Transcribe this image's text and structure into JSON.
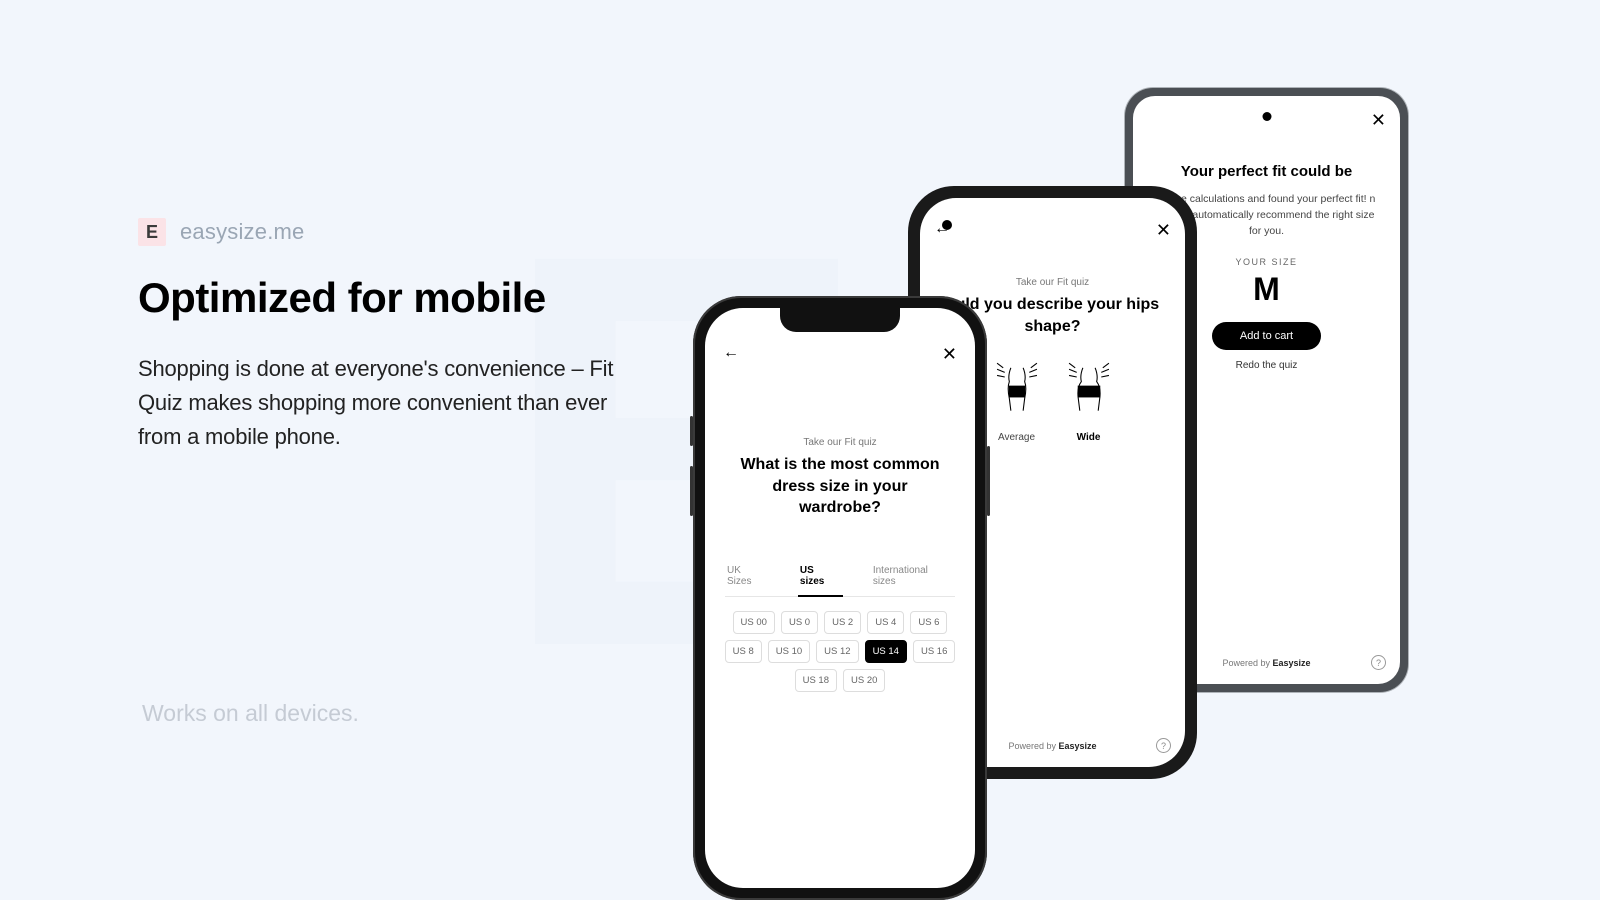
{
  "brand": {
    "badge": "E",
    "name": "easysize.me"
  },
  "title": "Optimized for mobile",
  "body": "Shopping is done at everyone's convenience – Fit Quiz makes shopping more convenient than ever from a mobile phone.",
  "footer": "Works on all devices.",
  "phoneA": {
    "label": "Take our Fit quiz",
    "question": "What is the most common dress size in your wardrobe?",
    "tabs": [
      "UK Sizes",
      "US sizes",
      "International sizes"
    ],
    "activeTab": 1,
    "sizes": [
      "US 00",
      "US 0",
      "US 2",
      "US 4",
      "US 6",
      "US 8",
      "US 10",
      "US 12",
      "US 14",
      "US 16",
      "US 18",
      "US 20"
    ],
    "activeSize": "US 14"
  },
  "phoneB": {
    "label_prefix": "Take our Fit quiz",
    "question_partial": "ould you describe your hips shape?",
    "options": [
      {
        "name": "Average",
        "bold": false
      },
      {
        "name": "Wide",
        "bold": true
      }
    ],
    "powered_pre": "Powered by ",
    "powered_brand": "Easysize"
  },
  "phoneC": {
    "heading": "Your perfect fit could be",
    "desc_partial": "ne the calculations and found your perfect fit! n we will automatically recommend the right size for you.",
    "your_size": "YOUR SIZE",
    "size": "M",
    "cta": "Add to cart",
    "redo": "Redo the quiz",
    "powered_pre": "Powered by ",
    "powered_brand": "Easysize"
  }
}
